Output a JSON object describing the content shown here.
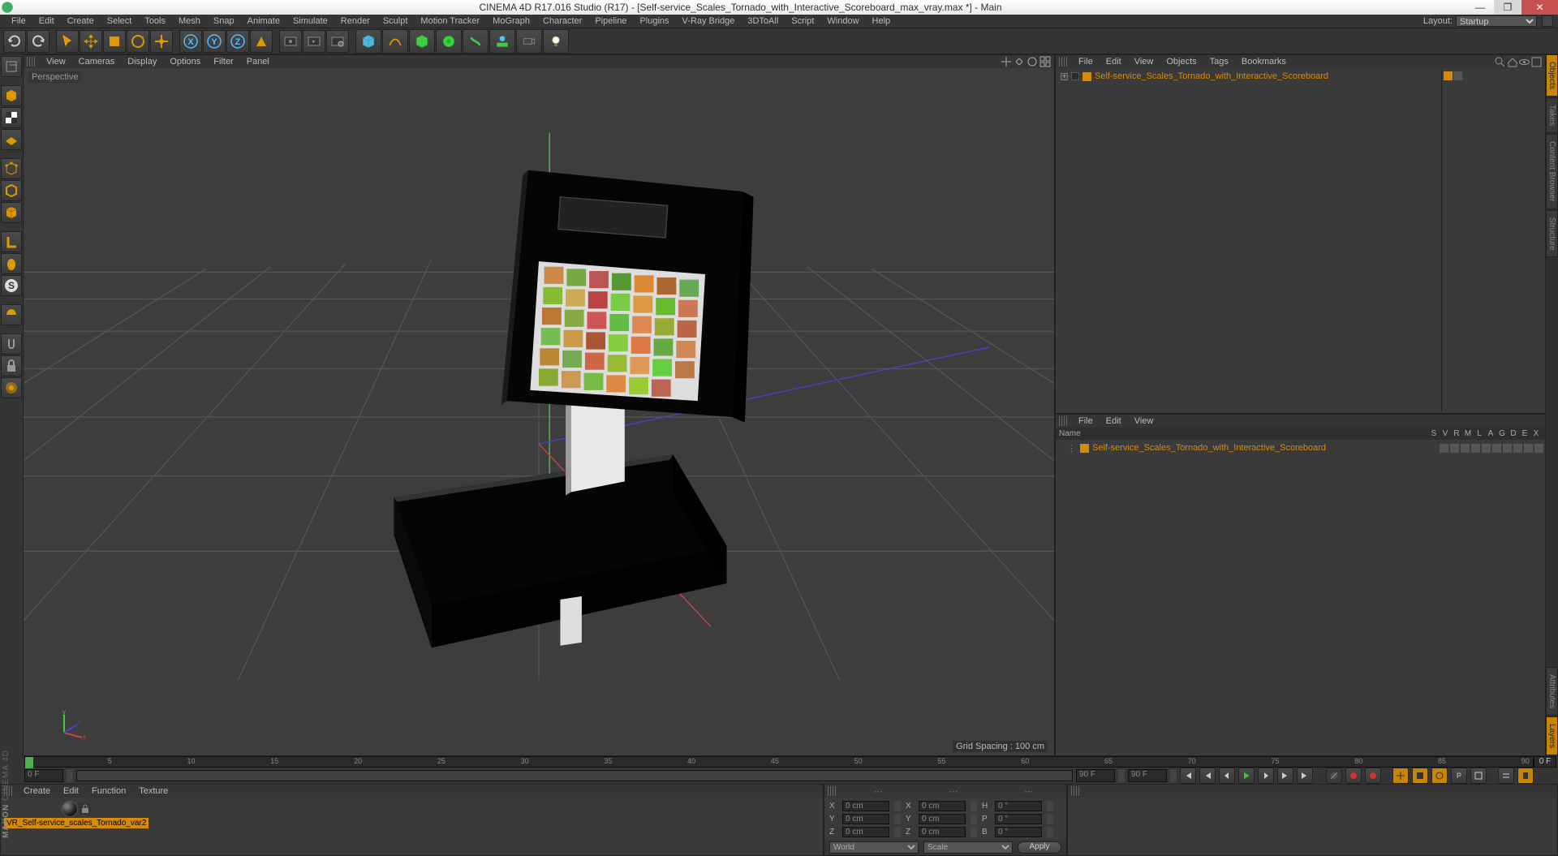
{
  "title": "CINEMA 4D R17.016 Studio (R17) - [Self-service_Scales_Tornado_with_Interactive_Scoreboard_max_vray.max *] - Main",
  "layout_label": "Layout:",
  "layout_value": "Startup",
  "menu": [
    "File",
    "Edit",
    "Create",
    "Select",
    "Tools",
    "Mesh",
    "Snap",
    "Animate",
    "Simulate",
    "Render",
    "Sculpt",
    "Motion Tracker",
    "MoGraph",
    "Character",
    "Pipeline",
    "Plugins",
    "V-Ray Bridge",
    "3DToAll",
    "Script",
    "Window",
    "Help"
  ],
  "vpmenu": [
    "View",
    "Cameras",
    "Display",
    "Options",
    "Filter",
    "Panel"
  ],
  "vp_label": "Perspective",
  "grid_spacing": "Grid Spacing : 100 cm",
  "obj_menu": [
    "File",
    "Edit",
    "View",
    "Objects",
    "Tags",
    "Bookmarks"
  ],
  "obj_root": "Self-service_Scales_Tornado_with_Interactive_Scoreboard",
  "attr_menu": [
    "File",
    "Edit",
    "View"
  ],
  "attr_cols": [
    "Name",
    "S",
    "V",
    "R",
    "M",
    "L",
    "A",
    "G",
    "D",
    "E",
    "X"
  ],
  "attr_row": "Self-service_Scales_Tornado_with_Interactive_Scoreboard",
  "right_tabs": [
    "Objects",
    "Takes",
    "Content Browser",
    "Structure",
    "Attributes",
    "Layers"
  ],
  "timeline": {
    "start": 0,
    "end": 90,
    "cur": "0 F",
    "step": 5
  },
  "play": {
    "from": "0 F",
    "to": "0 F",
    "a": "90 F",
    "b": "90 F"
  },
  "mat_menu": [
    "Create",
    "Edit",
    "Function",
    "Texture"
  ],
  "mat_name": "VR_Self-service_scales_Tornado_var2",
  "coord": {
    "pos": {
      "X": "0 cm",
      "Y": "0 cm",
      "Z": "0 cm"
    },
    "size": {
      "X": "0 cm",
      "Y": "0 cm",
      "Z": "0 cm"
    },
    "rot": {
      "H": "0 °",
      "P": "0 °",
      "B": "0 °"
    },
    "mode1": "World",
    "mode2": "Scale",
    "apply": "Apply"
  },
  "brand": "MAXON",
  "brand2": "CINEMA 4D"
}
